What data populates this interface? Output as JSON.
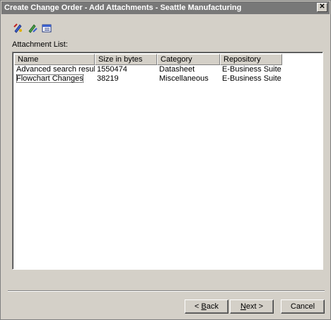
{
  "window": {
    "title": "Create Change Order - Add Attachments - Seattle Manufacturing",
    "close_glyph": "✕"
  },
  "toolbar": {
    "icons": [
      "attach-add-icon",
      "attach-edit-icon",
      "attach-properties-icon"
    ]
  },
  "attachments": {
    "label": "Attachment List:",
    "columns": [
      "Name",
      "Size in bytes",
      "Category",
      "Repository"
    ],
    "rows": [
      {
        "name": "Advanced search results",
        "size": "1550474",
        "category": "Datasheet",
        "repository": "E-Business Suite"
      },
      {
        "name": "Flowchart Changes",
        "size": "38219",
        "category": "Miscellaneous",
        "repository": "E-Business Suite"
      }
    ]
  },
  "buttons": {
    "back_prefix": "< ",
    "back_accel": "B",
    "back_rest": "ack",
    "next_accel": "N",
    "next_rest": "ext >",
    "cancel": "Cancel"
  }
}
